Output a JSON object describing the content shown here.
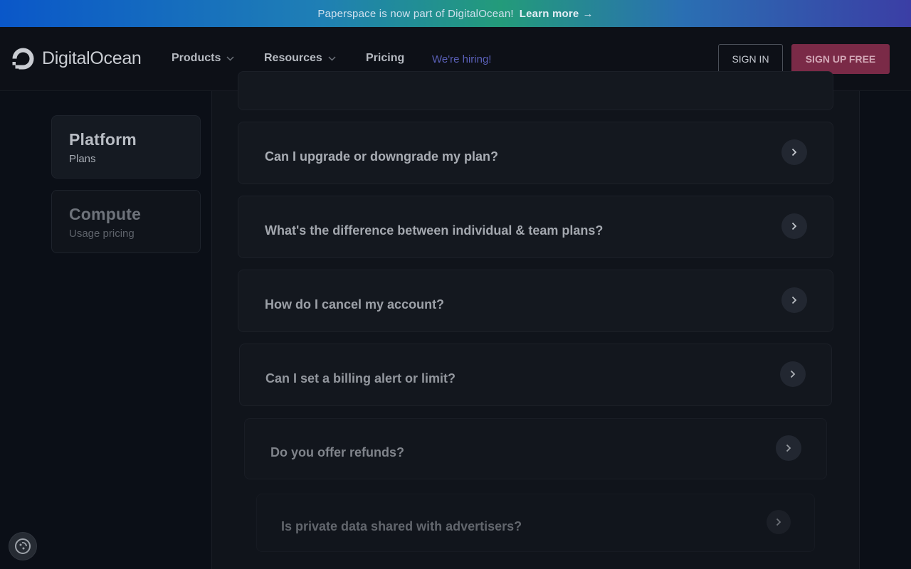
{
  "banner": {
    "text": "Paperspace is now part of DigitalOcean!",
    "link": "Learn more",
    "arrow": "→"
  },
  "nav": {
    "brand": "DigitalOcean",
    "products": "Products",
    "resources": "Resources",
    "pricing": "Pricing",
    "hiring": "We're hiring!",
    "sign_in": "SIGN IN",
    "sign_up": "SIGN UP FREE"
  },
  "sidebar": {
    "items": [
      {
        "title": "Platform",
        "subtitle": "Plans"
      },
      {
        "title": "Compute",
        "subtitle": "Usage pricing"
      }
    ]
  },
  "faq": {
    "items": [
      {
        "question": "Can I upgrade or downgrade my plan?"
      },
      {
        "question": "What's the difference between individual & team plans?"
      },
      {
        "question": "How do I cancel my account?"
      },
      {
        "question": "Can I set a billing alert or limit?"
      },
      {
        "question": "Do you offer refunds?"
      },
      {
        "question": "Is private data shared with advertisers?"
      }
    ]
  },
  "icons": {
    "logo": "digitalocean-logo-icon",
    "chevron_down": "chevron-down-icon",
    "chevron_right": "chevron-right-icon",
    "cookie": "cookie-settings-icon"
  },
  "colors": {
    "signup_button": "#7a2a47",
    "hiring_link": "#5a60b8",
    "background": "#0b0f17"
  }
}
